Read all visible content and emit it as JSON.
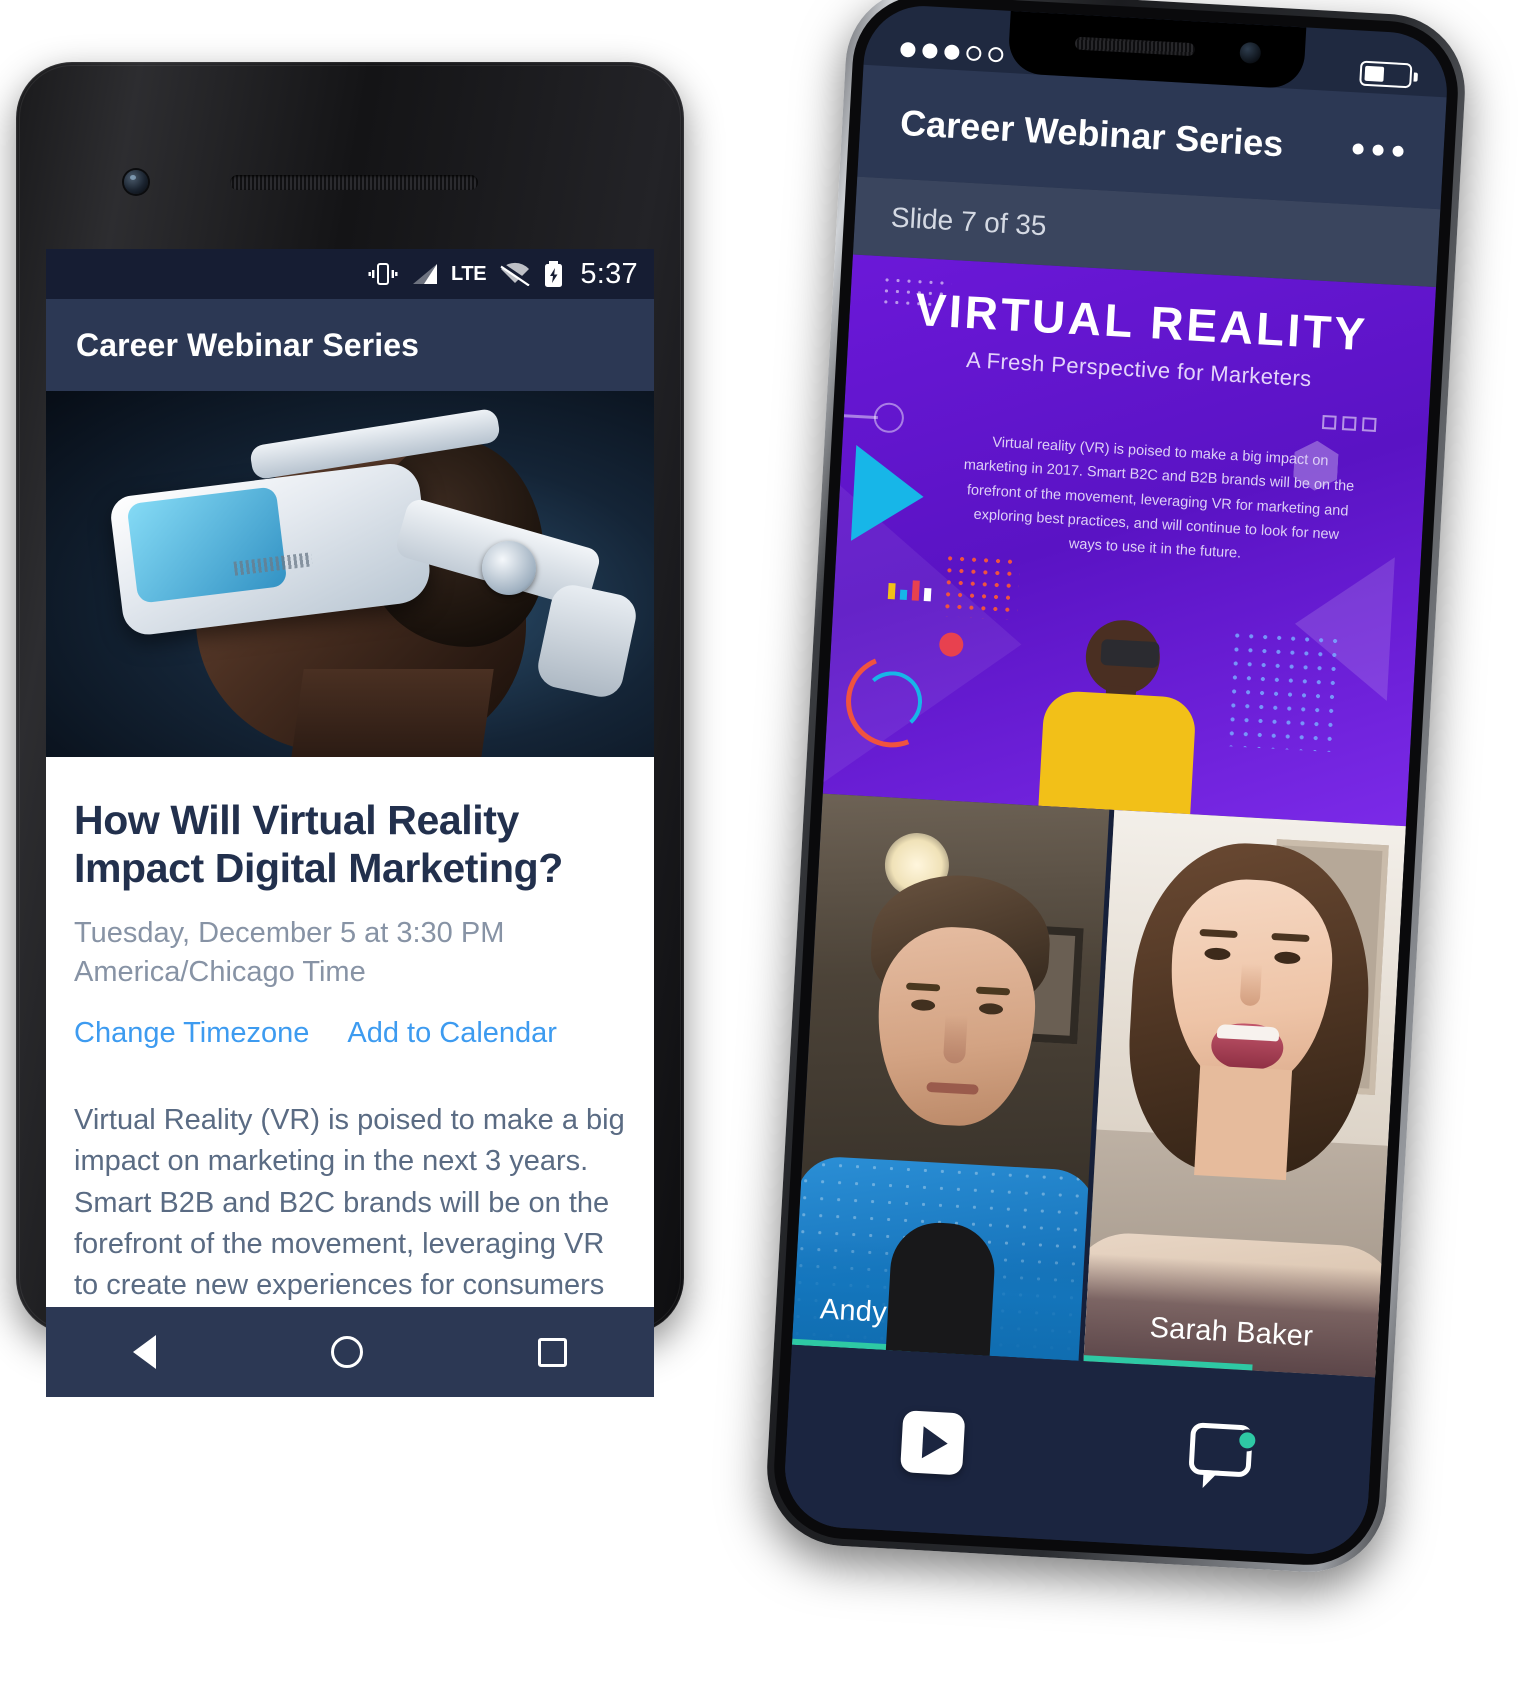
{
  "android": {
    "status_bar": {
      "time": "5:37",
      "network_type": "LTE",
      "icons": [
        "vibrate-icon",
        "signal-icon",
        "lte-label",
        "wifi-off-icon",
        "battery-charging-icon"
      ]
    },
    "app_bar": {
      "title": "Career Webinar Series"
    },
    "hero": {
      "alt": "man wearing white virtual reality headset"
    },
    "webinar": {
      "title": "How Will Virtual Reality Impact Digital Marketing?",
      "datetime": "Tuesday, December 5 at 3:30 PM",
      "timezone": "America/Chicago Time",
      "link_change_timezone": "Change Timezone",
      "link_add_to_calendar": "Add to Calendar",
      "description": "Virtual Reality (VR) is poised to make a big impact on marketing in the next 3 years. Smart B2B and B2C brands will be on the forefront of the movement, leveraging VR to create new experiences for consumers that"
    },
    "nav_bar": {
      "back": "back-icon",
      "home": "home-icon",
      "recents": "recents-icon"
    }
  },
  "ios": {
    "status_bar": {
      "signal_dots_filled": 3,
      "signal_dots_total": 5,
      "battery_level": "46%"
    },
    "app_bar": {
      "title": "Career Webinar Series",
      "menu": "more-options-icon"
    },
    "slide_counter": "Slide 7 of 35",
    "slide": {
      "title": "VIRTUAL REALITY",
      "subtitle": "A Fresh Perspective for Marketers",
      "body": "Virtual reality (VR) is poised to make a big impact on marketing in 2017. Smart B2C and B2B brands will be on the forefront of the movement, leveraging VR for marketing and exploring best practices, and will continue to look for new ways to use it in the future.",
      "accent_color": "#6b18d8"
    },
    "presenters": [
      {
        "name": "Andy Davis",
        "audio_level": 42,
        "level_color": "#2ec9a4"
      },
      {
        "name": "Sarah Baker",
        "audio_level": 58,
        "level_color": "#2ec9a4"
      }
    ],
    "controls": {
      "play": "play-icon",
      "chat": "chat-icon",
      "chat_badge_color": "#2ec9a4"
    }
  }
}
